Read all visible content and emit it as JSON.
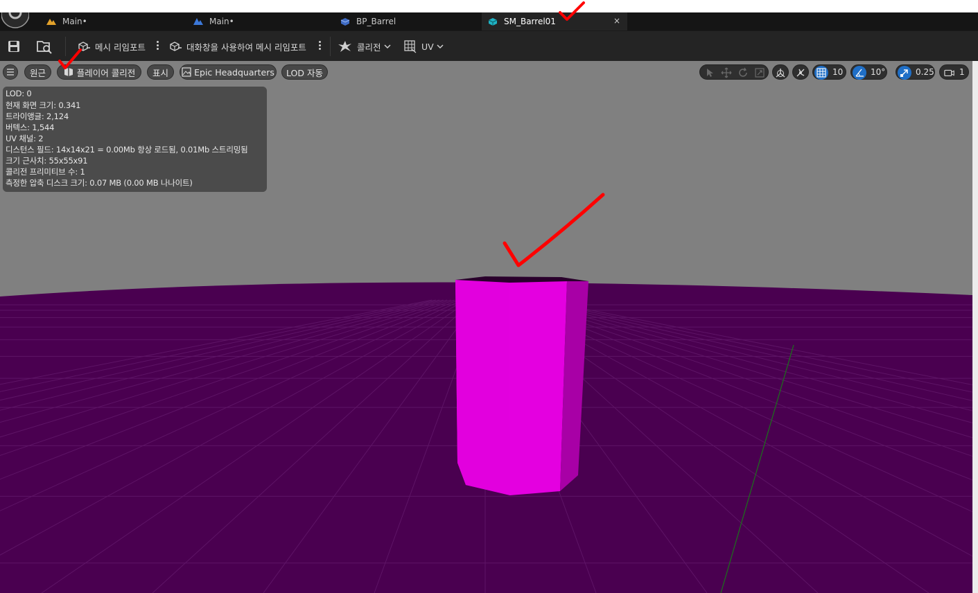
{
  "tabs": [
    {
      "label": "Main•",
      "icon": "level-icon",
      "active": false
    },
    {
      "label": "Main•",
      "icon": "level-blueprint-icon",
      "active": false
    },
    {
      "label": "BP_Barrel",
      "icon": "blueprint-icon",
      "active": false
    },
    {
      "label": "SM_Barrel01",
      "icon": "static-mesh-icon",
      "active": true,
      "close": "×"
    }
  ],
  "toolbar": {
    "reimport_label": "메시 리임포트",
    "reimport_dialog_label": "대화창을 사용하여 메시 리임포트",
    "collision_label": "콜리전",
    "uv_label": "UV"
  },
  "viewport_bar": {
    "perspective_label": "원근",
    "player_collision_label": "플레이어 콜리전",
    "show_label": "표시",
    "environment_label": "Epic Headquarters",
    "lod_label": "LOD 자동",
    "grid_snap_value": "10",
    "rotation_snap_value": "10°",
    "scale_snap_value": "0.25",
    "camera_speed_value": "1"
  },
  "info": [
    "LOD:  0",
    "현재 화면 크기: 0.341",
    "트라이앵글: 2,124",
    "버텍스: 1,544",
    "UV 채널:  2",
    "디스턴스 필드:  14x14x21 = 0.00Mb 항상 로드됨, 0.01Mb 스트리밍됨",
    "크기 근사치: 55x55x91",
    "콜리전 프리미티브 수: 1",
    "측정한 압축 디스크 크기: 0.07 MB (0.00 MB 나나이트)"
  ],
  "colors": {
    "floor": "#4a0050",
    "grid_line": "#5e1466",
    "mesh_front": "#e400e0",
    "mesh_side": "#a800a6",
    "mesh_top": "#2a002c",
    "sky": "#808080",
    "annotation": "#ff0000",
    "accent_blue": "#1f6fc7"
  }
}
